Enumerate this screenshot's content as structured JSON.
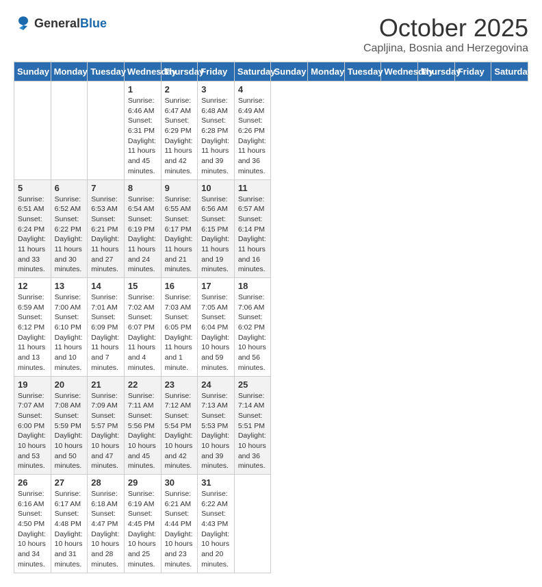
{
  "header": {
    "logo_general": "General",
    "logo_blue": "Blue",
    "month": "October 2025",
    "location": "Capljina, Bosnia and Herzegovina"
  },
  "days_of_week": [
    "Sunday",
    "Monday",
    "Tuesday",
    "Wednesday",
    "Thursday",
    "Friday",
    "Saturday"
  ],
  "weeks": [
    [
      {
        "day": "",
        "info": ""
      },
      {
        "day": "",
        "info": ""
      },
      {
        "day": "",
        "info": ""
      },
      {
        "day": "1",
        "info": "Sunrise: 6:46 AM\nSunset: 6:31 PM\nDaylight: 11 hours\nand 45 minutes."
      },
      {
        "day": "2",
        "info": "Sunrise: 6:47 AM\nSunset: 6:29 PM\nDaylight: 11 hours\nand 42 minutes."
      },
      {
        "day": "3",
        "info": "Sunrise: 6:48 AM\nSunset: 6:28 PM\nDaylight: 11 hours\nand 39 minutes."
      },
      {
        "day": "4",
        "info": "Sunrise: 6:49 AM\nSunset: 6:26 PM\nDaylight: 11 hours\nand 36 minutes."
      }
    ],
    [
      {
        "day": "5",
        "info": "Sunrise: 6:51 AM\nSunset: 6:24 PM\nDaylight: 11 hours\nand 33 minutes."
      },
      {
        "day": "6",
        "info": "Sunrise: 6:52 AM\nSunset: 6:22 PM\nDaylight: 11 hours\nand 30 minutes."
      },
      {
        "day": "7",
        "info": "Sunrise: 6:53 AM\nSunset: 6:21 PM\nDaylight: 11 hours\nand 27 minutes."
      },
      {
        "day": "8",
        "info": "Sunrise: 6:54 AM\nSunset: 6:19 PM\nDaylight: 11 hours\nand 24 minutes."
      },
      {
        "day": "9",
        "info": "Sunrise: 6:55 AM\nSunset: 6:17 PM\nDaylight: 11 hours\nand 21 minutes."
      },
      {
        "day": "10",
        "info": "Sunrise: 6:56 AM\nSunset: 6:15 PM\nDaylight: 11 hours\nand 19 minutes."
      },
      {
        "day": "11",
        "info": "Sunrise: 6:57 AM\nSunset: 6:14 PM\nDaylight: 11 hours\nand 16 minutes."
      }
    ],
    [
      {
        "day": "12",
        "info": "Sunrise: 6:59 AM\nSunset: 6:12 PM\nDaylight: 11 hours\nand 13 minutes."
      },
      {
        "day": "13",
        "info": "Sunrise: 7:00 AM\nSunset: 6:10 PM\nDaylight: 11 hours\nand 10 minutes."
      },
      {
        "day": "14",
        "info": "Sunrise: 7:01 AM\nSunset: 6:09 PM\nDaylight: 11 hours\nand 7 minutes."
      },
      {
        "day": "15",
        "info": "Sunrise: 7:02 AM\nSunset: 6:07 PM\nDaylight: 11 hours\nand 4 minutes."
      },
      {
        "day": "16",
        "info": "Sunrise: 7:03 AM\nSunset: 6:05 PM\nDaylight: 11 hours\nand 1 minute."
      },
      {
        "day": "17",
        "info": "Sunrise: 7:05 AM\nSunset: 6:04 PM\nDaylight: 10 hours\nand 59 minutes."
      },
      {
        "day": "18",
        "info": "Sunrise: 7:06 AM\nSunset: 6:02 PM\nDaylight: 10 hours\nand 56 minutes."
      }
    ],
    [
      {
        "day": "19",
        "info": "Sunrise: 7:07 AM\nSunset: 6:00 PM\nDaylight: 10 hours\nand 53 minutes."
      },
      {
        "day": "20",
        "info": "Sunrise: 7:08 AM\nSunset: 5:59 PM\nDaylight: 10 hours\nand 50 minutes."
      },
      {
        "day": "21",
        "info": "Sunrise: 7:09 AM\nSunset: 5:57 PM\nDaylight: 10 hours\nand 47 minutes."
      },
      {
        "day": "22",
        "info": "Sunrise: 7:11 AM\nSunset: 5:56 PM\nDaylight: 10 hours\nand 45 minutes."
      },
      {
        "day": "23",
        "info": "Sunrise: 7:12 AM\nSunset: 5:54 PM\nDaylight: 10 hours\nand 42 minutes."
      },
      {
        "day": "24",
        "info": "Sunrise: 7:13 AM\nSunset: 5:53 PM\nDaylight: 10 hours\nand 39 minutes."
      },
      {
        "day": "25",
        "info": "Sunrise: 7:14 AM\nSunset: 5:51 PM\nDaylight: 10 hours\nand 36 minutes."
      }
    ],
    [
      {
        "day": "26",
        "info": "Sunrise: 6:16 AM\nSunset: 4:50 PM\nDaylight: 10 hours\nand 34 minutes."
      },
      {
        "day": "27",
        "info": "Sunrise: 6:17 AM\nSunset: 4:48 PM\nDaylight: 10 hours\nand 31 minutes."
      },
      {
        "day": "28",
        "info": "Sunrise: 6:18 AM\nSunset: 4:47 PM\nDaylight: 10 hours\nand 28 minutes."
      },
      {
        "day": "29",
        "info": "Sunrise: 6:19 AM\nSunset: 4:45 PM\nDaylight: 10 hours\nand 25 minutes."
      },
      {
        "day": "30",
        "info": "Sunrise: 6:21 AM\nSunset: 4:44 PM\nDaylight: 10 hours\nand 23 minutes."
      },
      {
        "day": "31",
        "info": "Sunrise: 6:22 AM\nSunset: 4:43 PM\nDaylight: 10 hours\nand 20 minutes."
      },
      {
        "day": "",
        "info": ""
      }
    ]
  ]
}
